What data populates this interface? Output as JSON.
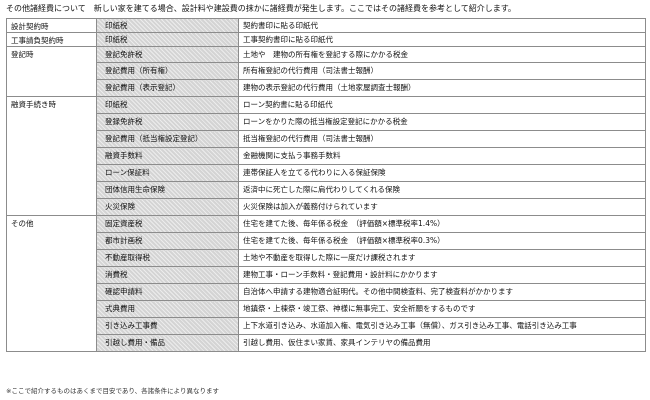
{
  "intro": "その他諸経費について　新しい家を建てる場合、設計料や建設費の抹かに諸経費が発生します。ここではその諸経費を参考として紹介します。",
  "groups": [
    {
      "category": "設計契約時",
      "rows": [
        {
          "name": "印紙税",
          "desc": "契約書印に貼る印紙代"
        }
      ]
    },
    {
      "category": "工事請負契約時",
      "rows": [
        {
          "name": "印紙税",
          "desc": "工事契約書印に貼る印紙代"
        }
      ]
    },
    {
      "category": "登記時",
      "rows": [
        {
          "name": "登記免許税",
          "desc": "土地や　建物の所有権を登記する際にかかる税金"
        },
        {
          "name": "登記費用（所有権）",
          "desc": "所有権登記の代行費用（司法書士報酬）"
        },
        {
          "name": "登記費用（表示登記）",
          "desc": "建物の表示登記の代行費用（土地家屋調査士報酬）"
        }
      ]
    },
    {
      "category": "融資手続き時",
      "rows": [
        {
          "name": "印紙税",
          "desc": "ローン契約書に貼る印紙代"
        },
        {
          "name": "登録免許税",
          "desc": "ローンをかりた際の抵当権設定登記にかかる税金"
        },
        {
          "name": "登記費用（抵当権設定登記）",
          "desc": "抵当権登記の代行費用（司法書士報酬）"
        },
        {
          "name": "融資手数料",
          "desc": "金融機関に支払う事務手数料"
        },
        {
          "name": "ローン保証料",
          "desc": "連帯保証人を立てる代わりに入る保証保険"
        },
        {
          "name": "団体信用生命保険",
          "desc": "返済中に死亡した際に肩代わりしてくれる保険"
        },
        {
          "name": "火災保険",
          "desc": "火災保険は加入が義務付けられています"
        }
      ]
    },
    {
      "category": "その他",
      "rows": [
        {
          "name": "固定資産税",
          "desc": "住宅を建てた後、毎年係る税金　（評価額×標準税率1.4%）"
        },
        {
          "name": "都市計画税",
          "desc": "住宅を建てた後、毎年係る税金　（評価額×標準税率0.3%）"
        },
        {
          "name": "不動産取得税",
          "desc": "土地や不動産を取得した際に一度だけ課税されます"
        },
        {
          "name": "消費税",
          "desc": "建物工事・ローン手数料・登記費用・設計料にかかります"
        },
        {
          "name": "確認申請料",
          "desc": "自治体へ申請する建物適合証明代。その他中間検査料、完了検査料がかかります"
        },
        {
          "name": "式典費用",
          "desc": "地鎮祭・上棟祭・竣工祭、神様に無事完工、安全祈願をするものです"
        },
        {
          "name": "引き込み工事費",
          "desc": "上下水道引き込み、水道加入権、電気引き込み工事（無償）、ガス引き込み工事、電話引き込み工事"
        },
        {
          "name": "引越し費用・備品",
          "desc": "引越し費用、仮住まい家賃、家具インテリヤの備品費用"
        }
      ]
    }
  ],
  "footnote": "※ここで紹介するものはあくまで目安であり、各諸条件により異なります"
}
